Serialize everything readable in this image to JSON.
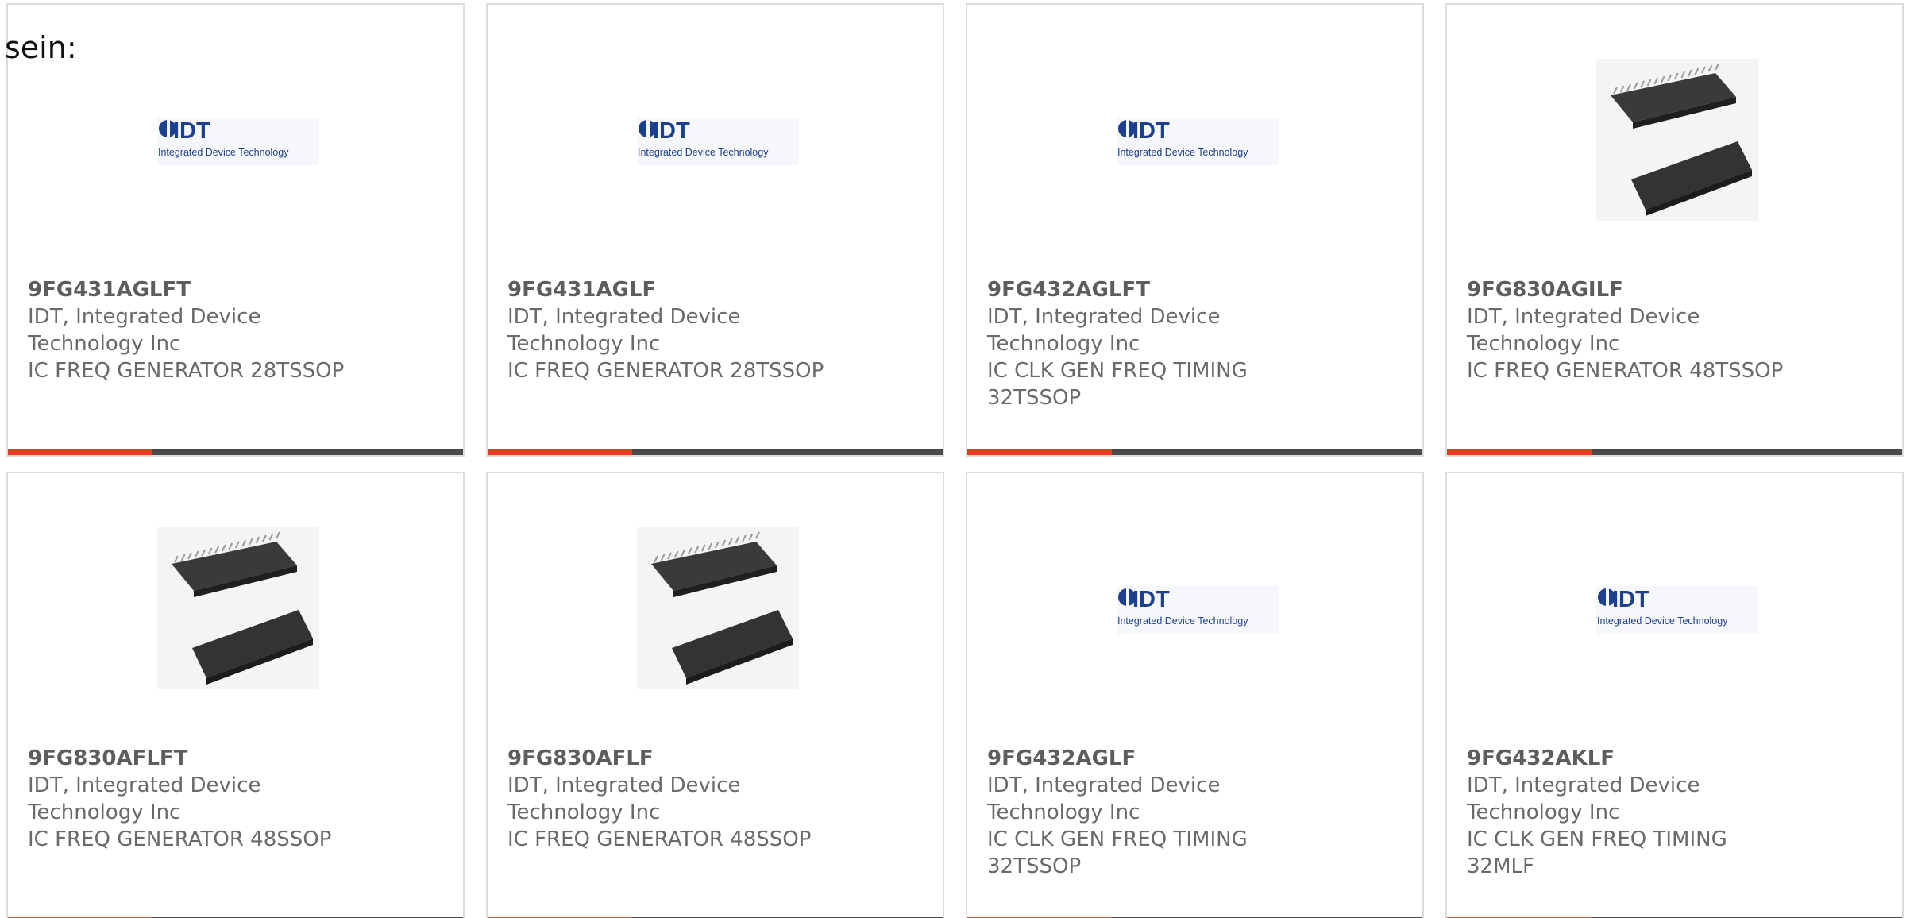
{
  "intro_text": "sein:",
  "colors": {
    "accent": "#e0401e",
    "bar": "#4a4a4a",
    "idt_blue": "#1d3f8f",
    "border": "#dcdcdc",
    "text": "#6a6a6a"
  },
  "products": [
    {
      "part": "9FG431AGLFT",
      "manufacturer": "IDT, Integrated Device Technology Inc",
      "description": "IC FREQ GENERATOR 28TSSOP",
      "image": "idt-logo"
    },
    {
      "part": "9FG431AGLF",
      "manufacturer": "IDT, Integrated Device Technology Inc",
      "description": "IC FREQ GENERATOR 28TSSOP",
      "image": "idt-logo"
    },
    {
      "part": "9FG432AGLFT",
      "manufacturer": "IDT, Integrated Device Technology Inc",
      "description": "IC CLK GEN FREQ TIMING 32TSSOP",
      "image": "idt-logo"
    },
    {
      "part": "9FG830AGILF",
      "manufacturer": "IDT, Integrated Device Technology Inc",
      "description": "IC FREQ GENERATOR 48TSSOP",
      "image": "ic-chip"
    },
    {
      "part": "9FG830AFLFT",
      "manufacturer": "IDT, Integrated Device Technology Inc",
      "description": "IC FREQ GENERATOR 48SSOP",
      "image": "ic-chip"
    },
    {
      "part": "9FG830AFLF",
      "manufacturer": "IDT, Integrated Device Technology Inc",
      "description": "IC FREQ GENERATOR 48SSOP",
      "image": "ic-chip"
    },
    {
      "part": "9FG432AGLF",
      "manufacturer": "IDT, Integrated Device Technology Inc",
      "description": "IC CLK GEN FREQ TIMING 32TSSOP",
      "image": "idt-logo"
    },
    {
      "part": "9FG432AKLF",
      "manufacturer": "IDT, Integrated Device Technology Inc",
      "description": "IC CLK GEN FREQ TIMING 32MLF",
      "image": "idt-logo"
    }
  ],
  "logo": {
    "wordmark": "IDT",
    "tagline": "Integrated Device Technology"
  }
}
